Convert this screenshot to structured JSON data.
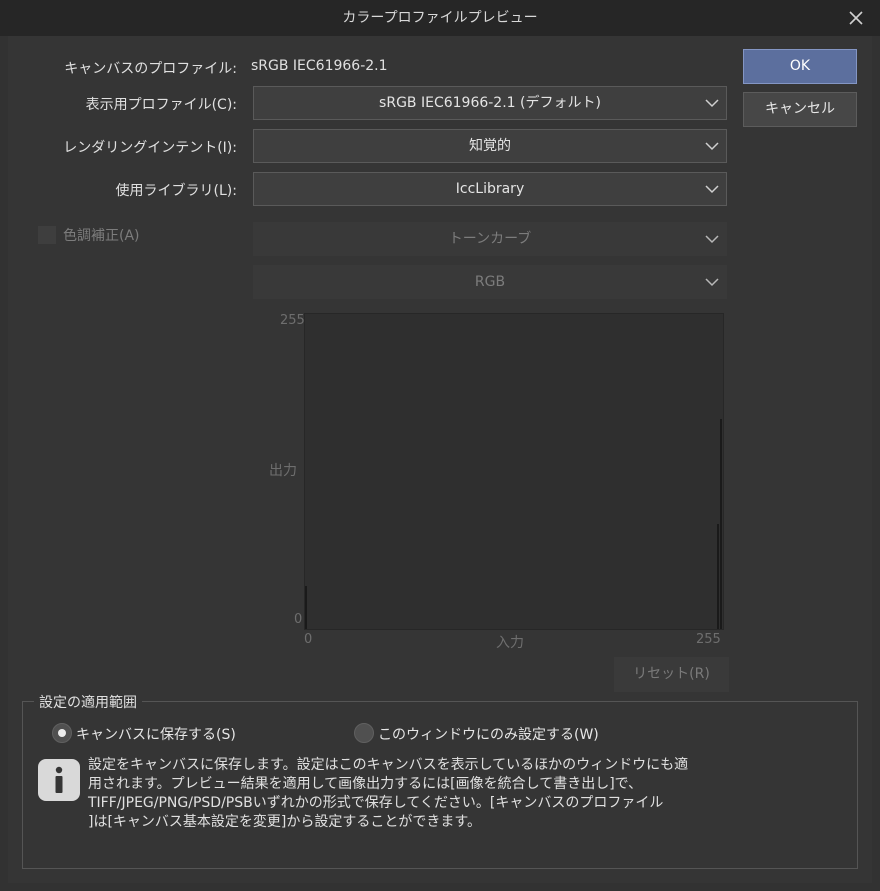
{
  "window": {
    "title": "カラープロファイルプレビュー"
  },
  "canvas_profile": {
    "label": "キャンバスのプロファイル:",
    "value": "sRGB IEC61966-2.1"
  },
  "display_profile": {
    "label": "表示用プロファイル(C):",
    "value": "sRGB IEC61966-2.1 (デフォルト)"
  },
  "rendering_intent": {
    "label": "レンダリングインテント(I):",
    "value": "知覚的"
  },
  "library": {
    "label": "使用ライブラリ(L):",
    "value": "IccLibrary"
  },
  "tone_correction": {
    "label": "色調補正(A)",
    "checked": false,
    "type_value": "トーンカーブ",
    "channel_value": "RGB"
  },
  "curve": {
    "y_label": "出力",
    "x_label": "入力",
    "y_max": "255",
    "y_min": "0",
    "x_min": "0",
    "x_max": "255"
  },
  "buttons": {
    "ok": "OK",
    "cancel": "キャンセル",
    "reset": "リセット(R)"
  },
  "scope": {
    "title": "設定の適用範囲",
    "options": [
      {
        "label": "キャンバスに保存する(S)",
        "selected": true
      },
      {
        "label": "このウィンドウにのみ設定する(W)",
        "selected": false
      }
    ],
    "info_lines": [
      "設定をキャンバスに保存します。設定はこのキャンバスを表示しているほかのウィンドウにも適",
      "用されます。プレビュー結果を適用して画像出力するには[画像を統合して書き出し]で、",
      "TIFF/JPEG/PNG/PSD/PSBいずれかの形式で保存してください。[キャンバスのプロファイル",
      "]は[キャンバス基本設定を変更]から設定することができます。"
    ]
  },
  "icons": {
    "close": "close-icon",
    "chevron": "chevron-down-icon",
    "info": "info-icon"
  }
}
